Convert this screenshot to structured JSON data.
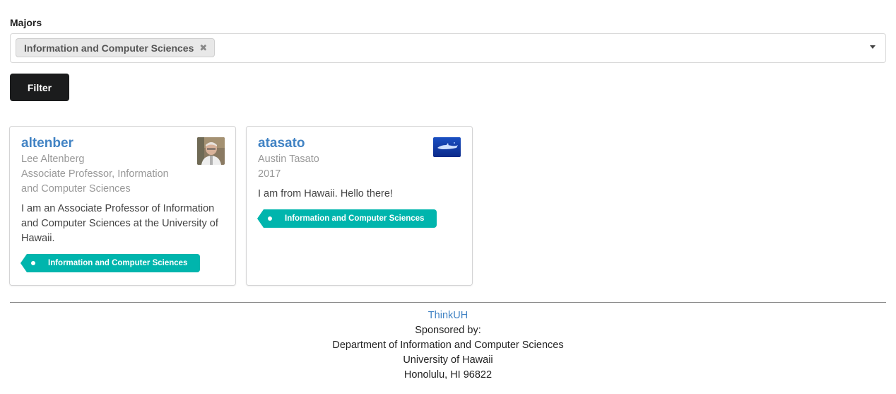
{
  "filter": {
    "label": "Majors",
    "selected": [
      "Information and Computer Sciences"
    ],
    "button_label": "Filter"
  },
  "profiles": [
    {
      "username": "altenber",
      "name": "Lee Altenberg",
      "title": "Associate Professor, Information and Computer Sciences",
      "bio": "I am an Associate Professor of Information and Computer Sciences at the University of Hawaii.",
      "tags": [
        "Information and Computer Sciences"
      ]
    },
    {
      "username": "atasato",
      "name": "Austin Tasato",
      "title": "2017",
      "bio": "I am from Hawaii. Hello there!",
      "tags": [
        "Information and Computer Sciences"
      ]
    }
  ],
  "footer": {
    "site": "ThinkUH",
    "sponsored": "Sponsored by:",
    "department": "Department of Information and Computer Sciences",
    "university": "University of Hawaii",
    "address": "Honolulu, HI 96822"
  },
  "colors": {
    "accent_link": "#4183c4",
    "tag_teal": "#00b5ad",
    "button_dark": "#1b1c1d"
  }
}
